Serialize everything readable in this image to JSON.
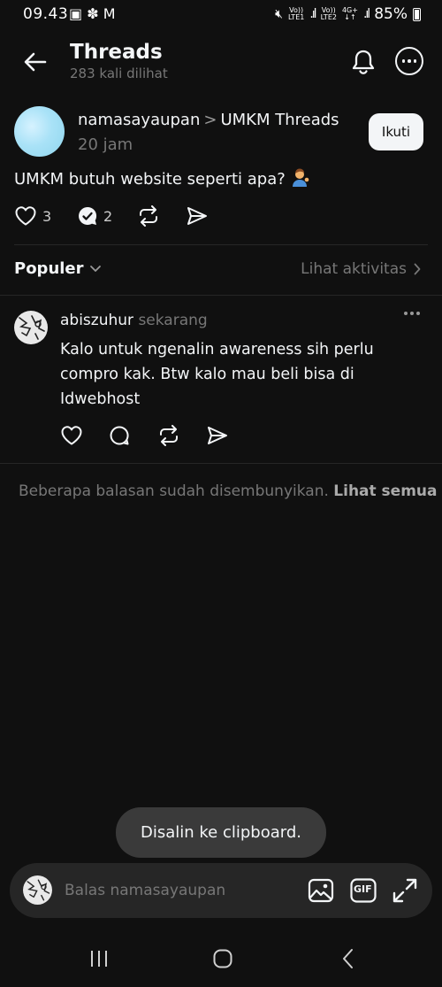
{
  "status_bar": {
    "time": "09.43",
    "sim1_tag_top": "Vo))",
    "sim1_tag_bottom": "LTE1",
    "sim2_tag_top": "Vo))",
    "sim2_tag_bottom": "LTE2",
    "network_tag": "4G+",
    "battery": "85%"
  },
  "header": {
    "title": "Threads",
    "subtitle": "283 kali dilihat"
  },
  "post": {
    "username": "namasayaupan",
    "separator": ">",
    "community": "UMKM Threads",
    "time": "20 jam",
    "follow_label": "Ikuti",
    "text": "UMKM butuh website seperti apa?",
    "likes": "3",
    "replies": "2"
  },
  "sort": {
    "label": "Populer",
    "activity_link": "Lihat aktivitas"
  },
  "reply": {
    "username": "abiszuhur",
    "time": "sekarang",
    "text": "Kalo untuk ngenalin awareness sih perlu compro kak. Btw kalo mau beli bisa di Idwebhost"
  },
  "hidden_replies": {
    "text": "Beberapa balasan sudah disembunyikan.",
    "link": "Lihat semua"
  },
  "toast": {
    "text": "Disalin ke clipboard."
  },
  "reply_bar": {
    "placeholder": "Balas namasayaupan",
    "gif_label": "GIF"
  },
  "colors": {
    "background": "#101010",
    "primary_text": "#f3f5f7",
    "secondary_text": "#777777",
    "avatar_accent": "#a9e2f7",
    "input_bg": "#262626",
    "toast_bg": "#3a3a3a"
  }
}
